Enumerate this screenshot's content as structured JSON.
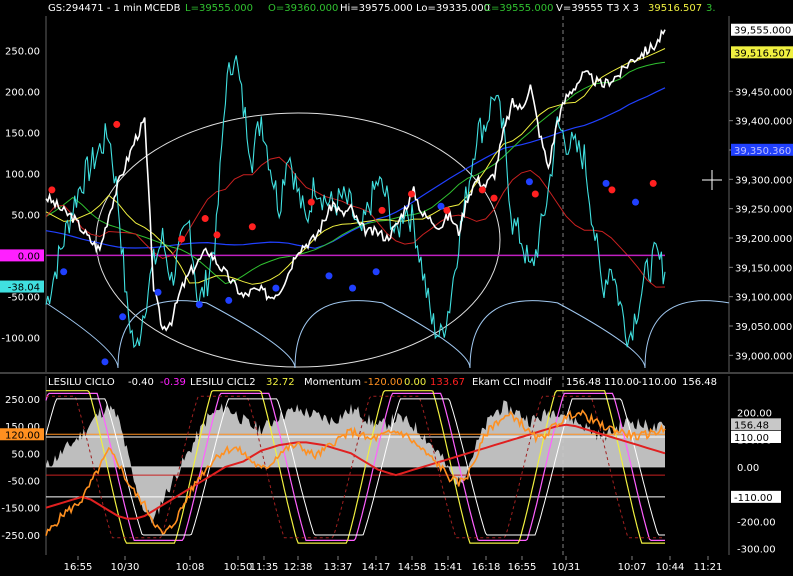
{
  "chart_data": [
    {
      "type": "line",
      "header": {
        "symbol": "GS:294471 - 1 min",
        "instrument": "MCEDB",
        "low": "L=39555.000",
        "open": "O=39360.000",
        "high": "Hi=39575.000",
        "lowb": "Lo=39335.000",
        "close": "C=39555.000",
        "vol": "V=39555",
        "mode": "T3 X 3",
        "readout": "39516.507",
        "readout2": "3."
      },
      "left_ticks": [
        "250.00",
        "200.00",
        "150.00",
        "100.00",
        "50.00",
        "0.00",
        "-50.00",
        "-100.00"
      ],
      "left_tick_values": [
        250,
        200,
        150,
        100,
        50,
        0,
        -50,
        -100
      ],
      "left_ylim": [
        -140,
        290
      ],
      "right_ticks": [
        "39,450.000",
        "39,400.000",
        "39,350.000",
        "39,300.000",
        "39,250.000",
        "39,200.000",
        "39,150.000",
        "39,100.000",
        "39,050.000",
        "39,000.000"
      ],
      "right_tick_values": [
        39450,
        39400,
        39350,
        39300,
        39250,
        39200,
        39150,
        39100,
        39050,
        39000
      ],
      "right_ylim": [
        38975,
        39575
      ],
      "price_label": "39,555.000",
      "price_value": 39555,
      "ma_label": "39,516.507",
      "ma_value": 39516.5,
      "blue_label": "39,350.360",
      "blue_value": 39350.36,
      "zero_label": "0.00",
      "cyan_label": "-38.04",
      "cyan_value": -38.04,
      "price_series": [
        39270,
        39258,
        39245,
        39235,
        39215,
        39195,
        39180,
        39240,
        39290,
        39330,
        39370,
        39400,
        39115,
        39045,
        39060,
        39110,
        39140,
        39160,
        39180,
        39160,
        39140,
        39120,
        39100,
        39110,
        39110,
        39100,
        39110,
        39140,
        39180,
        39190,
        39200,
        39230,
        39260,
        39240,
        39250,
        39220,
        39210,
        39210,
        39200,
        39220,
        39250,
        39280,
        39240,
        39230,
        39220,
        39240,
        39210,
        39270,
        39300,
        39290,
        39310,
        39380,
        39430,
        39420,
        39460,
        39380,
        39320,
        39400,
        39440,
        39460,
        39480,
        39470,
        39460,
        39470,
        39480,
        39500,
        39510,
        39520,
        39530,
        39555
      ],
      "cyan_series": [
        -60,
        -20,
        20,
        60,
        90,
        110,
        130,
        150,
        70,
        -60,
        -120,
        -60,
        -10,
        20,
        -30,
        10,
        40,
        -60,
        -30,
        30,
        200,
        250,
        180,
        120,
        170,
        110,
        60,
        130,
        80,
        40,
        90,
        70,
        60,
        70,
        60,
        20,
        60,
        90,
        70,
        20,
        60,
        40,
        -20,
        -80,
        -100,
        -60,
        20,
        80,
        150,
        160,
        200,
        150,
        40,
        20,
        -20,
        20,
        80,
        160,
        140,
        130,
        120,
        40,
        -40,
        -10,
        -60,
        -100,
        -60,
        -20,
        0,
        -20
      ],
      "red_dots": [
        [
          1,
          80
        ],
        [
          12,
          160
        ],
        [
          23,
          20
        ],
        [
          27,
          45
        ],
        [
          29,
          25
        ],
        [
          35,
          35
        ],
        [
          45,
          65
        ],
        [
          57,
          55
        ],
        [
          62,
          75
        ],
        [
          68,
          55
        ],
        [
          74,
          80
        ],
        [
          76,
          70
        ],
        [
          83,
          75
        ],
        [
          96,
          80
        ],
        [
          103,
          88
        ]
      ],
      "blue_dots": [
        [
          3,
          -20
        ],
        [
          10,
          -130
        ],
        [
          13,
          -75
        ],
        [
          19,
          -45
        ],
        [
          26,
          -60
        ],
        [
          31,
          -55
        ],
        [
          39,
          -40
        ],
        [
          48,
          -25
        ],
        [
          52,
          -40
        ],
        [
          56,
          -20
        ],
        [
          67,
          60
        ],
        [
          82,
          90
        ],
        [
          95,
          88
        ],
        [
          100,
          65
        ]
      ]
    },
    {
      "type": "line",
      "legend": {
        "name1": "LESILU CICLO",
        "val1": "-0.40",
        "val1b": "-0.39",
        "name2": "LESILU CICL2",
        "val2": "32.72",
        "name3": "Momentum",
        "val3": "-120.00",
        "val3b": "0.00",
        "val3c": "133.67",
        "name4": "Ekam CCI modif",
        "val4": "156.48",
        "val4b": "110.00",
        "val4c": "-110.00",
        "val4d": "156.48"
      },
      "left_ticks": [
        "250.00",
        "150.00",
        "50.00",
        "-50.00",
        "-150.00",
        "-250.00"
      ],
      "left_tick_values": [
        250,
        150,
        50,
        -50,
        -150,
        -250
      ],
      "left_ylim": [
        -320,
        290
      ],
      "marker_label": "120.00",
      "marker_value": 120,
      "right_ticks": [
        "200.00",
        "100.00",
        "0.00",
        "-100.00",
        "-200.00",
        "-300.00"
      ],
      "right_tick_values": [
        200,
        100,
        0,
        -100,
        -200,
        -300
      ],
      "right_labels": {
        "a": "156.48",
        "a_value": 156.48,
        "b": "110.00",
        "b_value": 110,
        "c": "-110.00",
        "c_value": -110
      },
      "orange_series": [
        -250,
        -210,
        -170,
        -150,
        -120,
        -60,
        0,
        60,
        20,
        -50,
        -100,
        -140,
        -200,
        -250,
        -220,
        -160,
        -100,
        -40,
        0,
        40,
        60,
        70,
        50,
        20,
        -10,
        10,
        50,
        70,
        80,
        60,
        40,
        60,
        90,
        110,
        130,
        120,
        100,
        110,
        120,
        130,
        120,
        90,
        60,
        30,
        0,
        -40,
        -60,
        -30,
        40,
        120,
        160,
        180,
        190,
        160,
        120,
        100,
        130,
        160,
        180,
        200,
        190,
        170,
        150,
        140,
        130,
        120,
        110,
        120,
        130,
        140
      ],
      "red_series": [
        -150,
        -140,
        -130,
        -120,
        -110,
        -120,
        -140,
        -160,
        -180,
        -190,
        -190,
        -180,
        -160,
        -140,
        -120,
        -100,
        -80,
        -60,
        -40,
        -20,
        0,
        10,
        20,
        40,
        60,
        70,
        80,
        85,
        90,
        90,
        85,
        80,
        70,
        60,
        50,
        30,
        10,
        -10,
        -20,
        -30,
        -20,
        -10,
        0,
        10,
        20,
        30,
        40,
        50,
        60,
        70,
        80,
        90,
        100,
        110,
        120,
        130,
        140,
        150,
        155,
        150,
        140,
        130,
        120,
        110,
        100,
        90,
        80,
        70,
        60,
        50
      ],
      "gray_series": [
        0,
        30,
        60,
        90,
        120,
        160,
        200,
        220,
        180,
        60,
        -80,
        -160,
        -200,
        -120,
        -60,
        0,
        60,
        120,
        180,
        200,
        220,
        200,
        170,
        150,
        140,
        160,
        190,
        200,
        210,
        200,
        190,
        180,
        170,
        190,
        210,
        200,
        170,
        150,
        160,
        180,
        170,
        150,
        120,
        80,
        40,
        -20,
        -60,
        0,
        80,
        150,
        200,
        220,
        210,
        190,
        170,
        180,
        200,
        210,
        190,
        170,
        150,
        130,
        110,
        130,
        150,
        170,
        160,
        150,
        140,
        150
      ]
    }
  ],
  "x_labels": [
    "16:55",
    "10/30",
    "10:08",
    "10:50",
    "11:35",
    "12:38",
    "13:37",
    "14:17",
    "14:58",
    "15:41",
    "16:18",
    "16:55",
    "10/31",
    "10:07",
    "10:44",
    "11:21"
  ],
  "colors": {
    "price": "#ffffff",
    "cyan": "#40e0e0",
    "red": "#c82020",
    "blue": "#2040ff",
    "yellow": "#f0f040",
    "green": "#30c030",
    "magenta": "#ff20ff",
    "orange": "#ff9020",
    "gray": "#c8c8c8"
  }
}
